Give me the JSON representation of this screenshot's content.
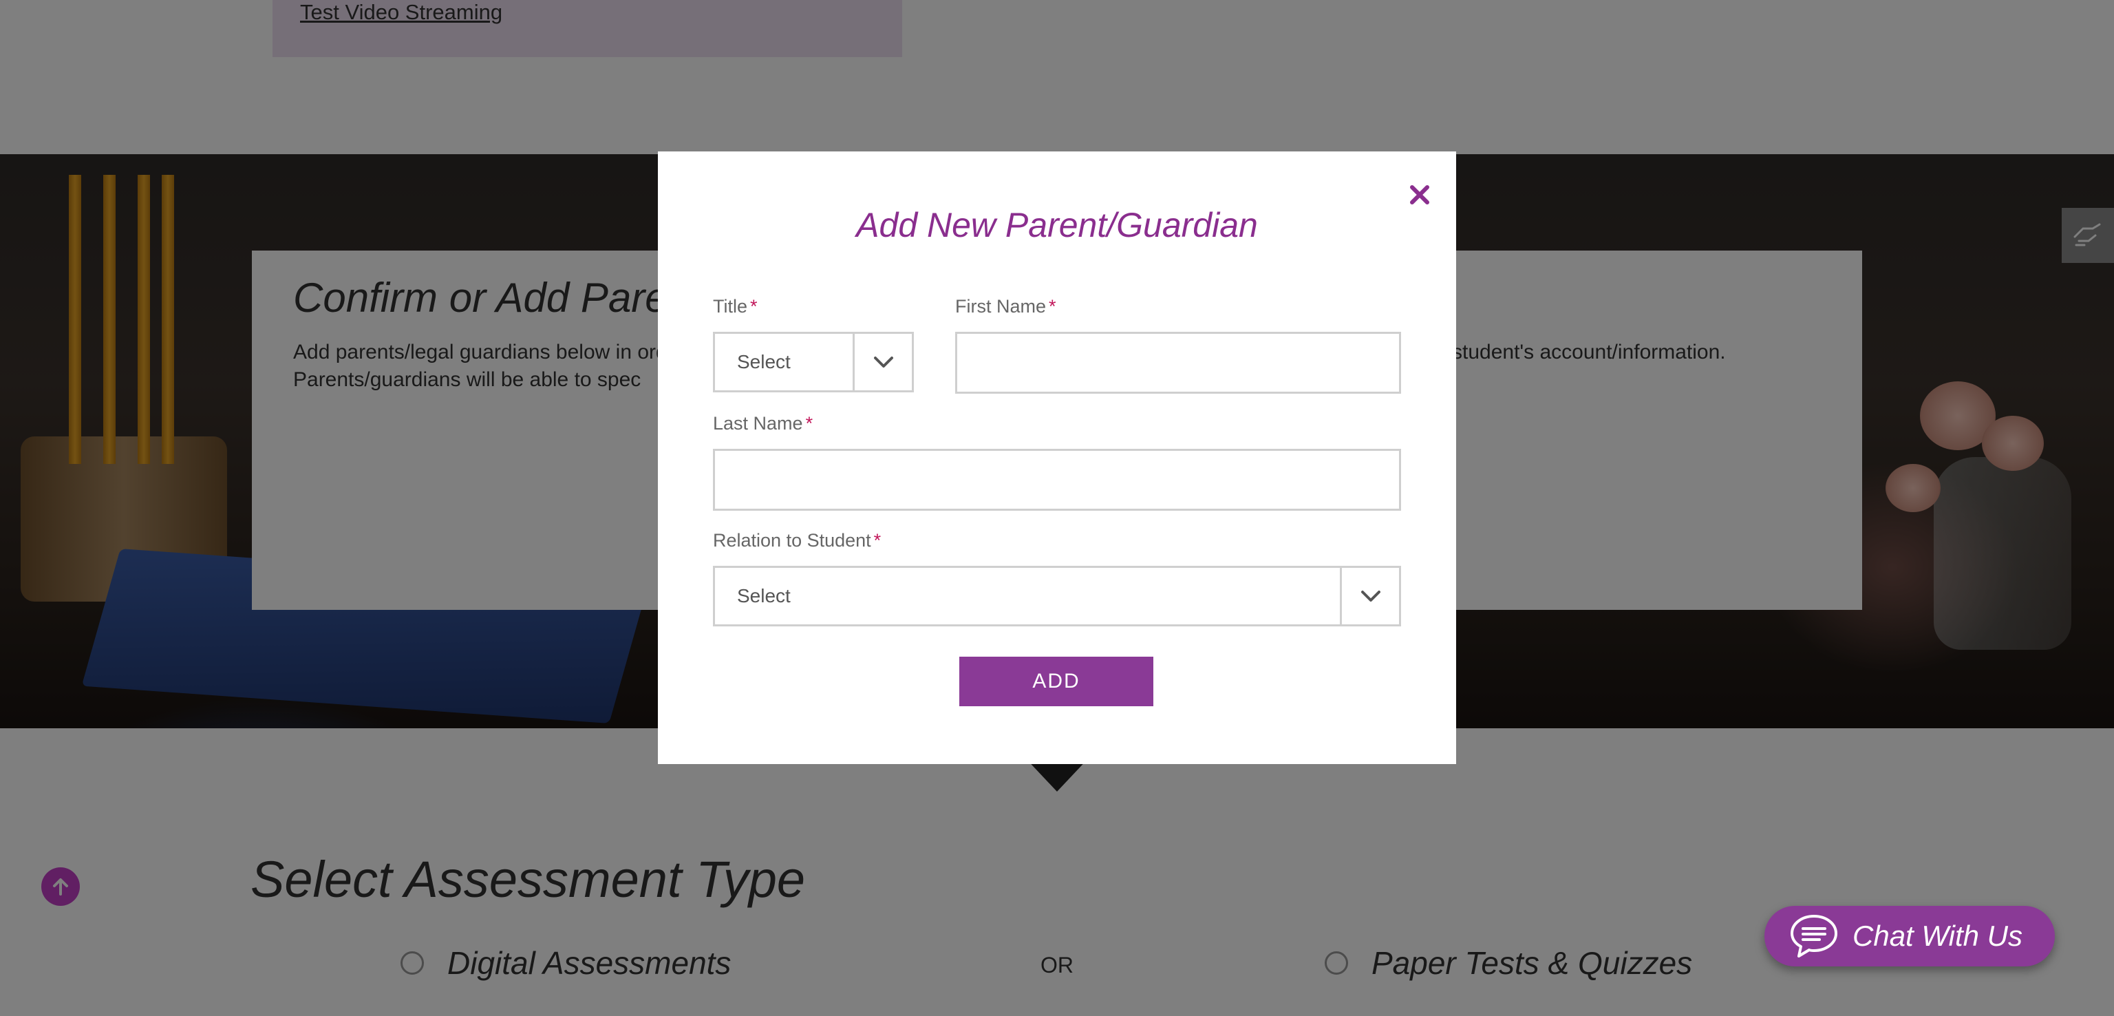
{
  "background": {
    "top_link": "Test Video Streaming",
    "hero": {
      "title": "Confirm or Add Parents/Guardians",
      "line1": "Add parents/legal guardians below in order to allow them access to this",
      "line1_right": "student's account/information.",
      "line2": "Parents/guardians will be able to spec"
    },
    "section_title": "Select Assessment Type",
    "options": {
      "digital": "Digital Assessments",
      "or": "OR",
      "paper": "Paper Tests & Quizzes"
    },
    "chat_label": "Chat With Us",
    "colors": {
      "accent": "#8a3a96",
      "scroll_top": "#c33fc7"
    }
  },
  "modal": {
    "title": "Add New Parent/Guardian",
    "close_icon": "close-icon",
    "fields": {
      "title_label": "Title",
      "title_value": "Select",
      "first_name_label": "First Name",
      "first_name_value": "",
      "last_name_label": "Last Name",
      "last_name_value": "",
      "relation_label": "Relation to Student",
      "relation_value": "Select"
    },
    "required_mark": "*",
    "add_label": "ADD",
    "colors": {
      "title": "#8a2e8e",
      "required": "#c2185b",
      "button": "#8a3a96"
    }
  }
}
